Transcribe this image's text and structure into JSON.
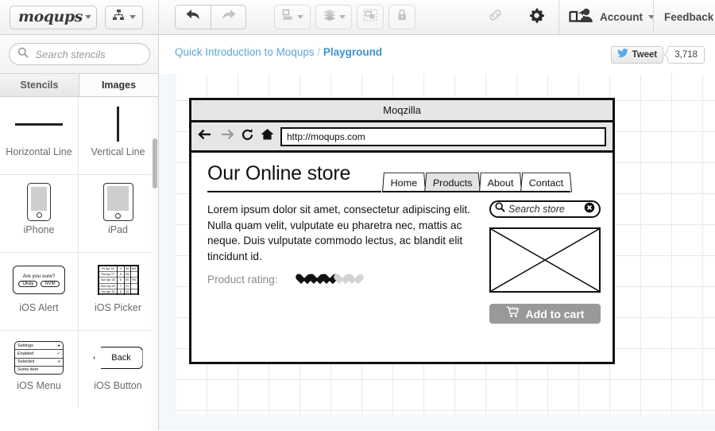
{
  "toolbar": {
    "logo_text": "moqups",
    "logo_caret": "caret-down-icon",
    "sitemap_icon": "sitemap-icon",
    "undo_label": "undo-icon",
    "redo_label": "redo-icon",
    "align_icon": "align-icon",
    "arrange_icon": "layers-icon",
    "group_icon": "group-icon",
    "lock_icon": "lock-icon",
    "link_icon": "link-icon",
    "settings_icon": "gear-icon",
    "share_icon": "share-icon",
    "account_label": "Account",
    "feedback_label": "Feedback"
  },
  "sidebar": {
    "search_placeholder": "Search stencils",
    "search_value": "",
    "tabs": [
      {
        "label": "Stencils",
        "active": false
      },
      {
        "label": "Images",
        "active": true
      }
    ],
    "stencils": [
      {
        "label": "Horizontal Line",
        "thumb": "horizontal-line"
      },
      {
        "label": "Vertical Line",
        "thumb": "vertical-line"
      },
      {
        "label": "iPhone",
        "thumb": "iphone"
      },
      {
        "label": "iPad",
        "thumb": "ipad"
      },
      {
        "label": "iOS Alert",
        "thumb": "ios-alert"
      },
      {
        "label": "iOS Picker",
        "thumb": "ios-picker"
      },
      {
        "label": "iOS Menu",
        "thumb": "ios-menu"
      },
      {
        "label": "iOS Button",
        "thumb": "ios-button"
      }
    ],
    "alert_stencil": {
      "message": "Are you sure?",
      "ok_label": "Okay",
      "cancel_label": "NVM"
    },
    "picker_stencil": {
      "rows": [
        [
          "Fri  Apr 26",
          "4",
          "55",
          "AM"
        ],
        [
          "Sat  Apr 27",
          "5",
          "59",
          ""
        ],
        [
          "Sun Apr 28",
          "6",
          "00",
          "PM"
        ],
        [
          "Mon Apr 29",
          "7",
          "01",
          ""
        ],
        [
          "Tue Apr 30",
          "8",
          "02",
          ""
        ]
      ]
    },
    "menu_stencil": {
      "items": [
        {
          "label": "Settings",
          "mark": "▸"
        },
        {
          "label": "Enabled",
          "mark": "✓"
        },
        {
          "label": "Selected",
          "mark": "≡"
        },
        {
          "label": "Some item",
          "mark": ""
        }
      ]
    },
    "button_stencil": {
      "label": "Back"
    }
  },
  "breadcrumb": {
    "project": "Quick Introduction to Moqups",
    "separator": "/",
    "page": "Playground"
  },
  "social": {
    "tweet_label": "Tweet",
    "tweet_count": "3,718",
    "twitter_icon": "twitter-bird-icon"
  },
  "mockup": {
    "browser": {
      "window_title": "Moqzilla",
      "back_icon": "arrow-left-icon",
      "forward_icon": "arrow-right-icon",
      "reload_icon": "reload-icon",
      "home_icon": "home-icon",
      "url": "http://moqups.com"
    },
    "page": {
      "heading": "Our Online store",
      "tabs": [
        {
          "label": "Home",
          "selected": false
        },
        {
          "label": "Products",
          "selected": true
        },
        {
          "label": "About",
          "selected": false
        },
        {
          "label": "Contact",
          "selected": false
        }
      ],
      "paragraph": "Lorem ipsum dolor sit amet, consectetur adipiscing elit. Nulla quam velit, vulputate eu pharetra nec, mattis ac neque. Duis vulputate commodo lectus, ac blandit elit tincidunt id.",
      "rating_label": "Product rating:",
      "rating_filled": 3,
      "rating_total": 5,
      "search_placeholder": "Search store",
      "search_icon": "magnifier-icon",
      "search_clear_icon": "clear-circle-icon",
      "image_placeholder": "image-placeholder",
      "cart_button_label": "Add to cart",
      "cart_icon": "shopping-cart-icon"
    }
  },
  "colors": {
    "accent_blue": "#5ba7d8",
    "accent_blue_bold": "#3f93cf",
    "twitter_blue": "#55acee",
    "canvas_bg": "#f4f7fb",
    "wire_black": "#111111",
    "cart_gray": "#999999",
    "heart_off": "#d3d3d3"
  }
}
